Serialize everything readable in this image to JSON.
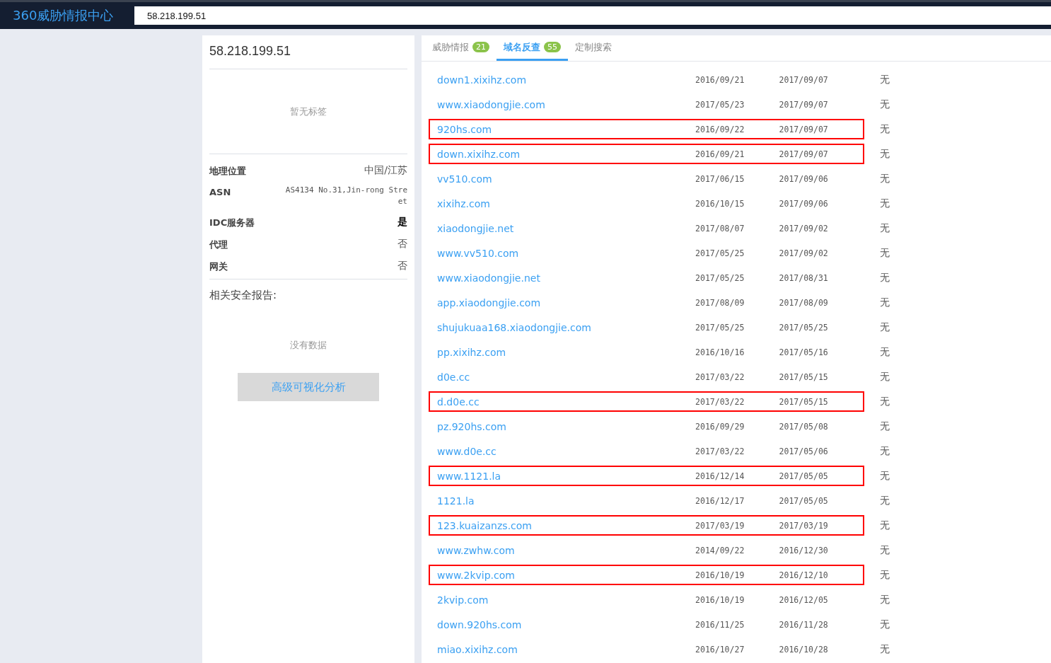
{
  "header": {
    "logo": "360威胁情报中心",
    "search_value": "58.218.199.51"
  },
  "summary": {
    "ip": "58.218.199.51",
    "tags_empty": "暂无标签",
    "info": [
      {
        "label": "地理位置",
        "value": "中国/江苏",
        "kind": "text"
      },
      {
        "label": "ASN",
        "value": "AS4134 No.31,Jin-rong Street",
        "kind": "mono"
      },
      {
        "label": "IDC服务器",
        "value": "是",
        "kind": "flag"
      },
      {
        "label": "代理",
        "value": "否",
        "kind": "text"
      },
      {
        "label": "网关",
        "value": "否",
        "kind": "text"
      }
    ],
    "reports_title": "相关安全报告:",
    "reports_empty": "没有数据",
    "button": "高级可视化分析"
  },
  "tabs": [
    {
      "label": "威胁情报",
      "count": "21",
      "selected": false
    },
    {
      "label": "域名反查",
      "count": "55",
      "selected": true
    },
    {
      "label": "定制搜索",
      "selected": false
    }
  ],
  "rows": [
    {
      "domain": "down1.xixihz.com",
      "first": "2016/09/21",
      "last": "2017/09/07",
      "note": "无",
      "highlighted": false
    },
    {
      "domain": "www.xiaodongjie.com",
      "first": "2017/05/23",
      "last": "2017/09/07",
      "note": "无",
      "highlighted": false
    },
    {
      "domain": "920hs.com",
      "first": "2016/09/22",
      "last": "2017/09/07",
      "note": "无",
      "highlighted": true
    },
    {
      "domain": "down.xixihz.com",
      "first": "2016/09/21",
      "last": "2017/09/07",
      "note": "无",
      "highlighted": true
    },
    {
      "domain": "vv510.com",
      "first": "2017/06/15",
      "last": "2017/09/06",
      "note": "无",
      "highlighted": false
    },
    {
      "domain": "xixihz.com",
      "first": "2016/10/15",
      "last": "2017/09/06",
      "note": "无",
      "highlighted": false
    },
    {
      "domain": "xiaodongjie.net",
      "first": "2017/08/07",
      "last": "2017/09/02",
      "note": "无",
      "highlighted": false
    },
    {
      "domain": "www.vv510.com",
      "first": "2017/05/25",
      "last": "2017/09/02",
      "note": "无",
      "highlighted": false
    },
    {
      "domain": "www.xiaodongjie.net",
      "first": "2017/05/25",
      "last": "2017/08/31",
      "note": "无",
      "highlighted": false
    },
    {
      "domain": "app.xiaodongjie.com",
      "first": "2017/08/09",
      "last": "2017/08/09",
      "note": "无",
      "highlighted": false
    },
    {
      "domain": "shujukuaa168.xiaodongjie.com",
      "first": "2017/05/25",
      "last": "2017/05/25",
      "note": "无",
      "highlighted": false
    },
    {
      "domain": "pp.xixihz.com",
      "first": "2016/10/16",
      "last": "2017/05/16",
      "note": "无",
      "highlighted": false
    },
    {
      "domain": "d0e.cc",
      "first": "2017/03/22",
      "last": "2017/05/15",
      "note": "无",
      "highlighted": false
    },
    {
      "domain": "d.d0e.cc",
      "first": "2017/03/22",
      "last": "2017/05/15",
      "note": "无",
      "highlighted": true
    },
    {
      "domain": "pz.920hs.com",
      "first": "2016/09/29",
      "last": "2017/05/08",
      "note": "无",
      "highlighted": false
    },
    {
      "domain": "www.d0e.cc",
      "first": "2017/03/22",
      "last": "2017/05/06",
      "note": "无",
      "highlighted": false
    },
    {
      "domain": "www.1121.la",
      "first": "2016/12/14",
      "last": "2017/05/05",
      "note": "无",
      "highlighted": true
    },
    {
      "domain": "1121.la",
      "first": "2016/12/17",
      "last": "2017/05/05",
      "note": "无",
      "highlighted": false
    },
    {
      "domain": "123.kuaizanzs.com",
      "first": "2017/03/19",
      "last": "2017/03/19",
      "note": "无",
      "highlighted": true
    },
    {
      "domain": "www.zwhw.com",
      "first": "2014/09/22",
      "last": "2016/12/30",
      "note": "无",
      "highlighted": false
    },
    {
      "domain": "www.2kvip.com",
      "first": "2016/10/19",
      "last": "2016/12/10",
      "note": "无",
      "highlighted": true
    },
    {
      "domain": "2kvip.com",
      "first": "2016/10/19",
      "last": "2016/12/05",
      "note": "无",
      "highlighted": false
    },
    {
      "domain": "down.920hs.com",
      "first": "2016/11/25",
      "last": "2016/11/28",
      "note": "无",
      "highlighted": false
    },
    {
      "domain": "miao.xixihz.com",
      "first": "2016/10/27",
      "last": "2016/10/28",
      "note": "无",
      "highlighted": false
    }
  ]
}
